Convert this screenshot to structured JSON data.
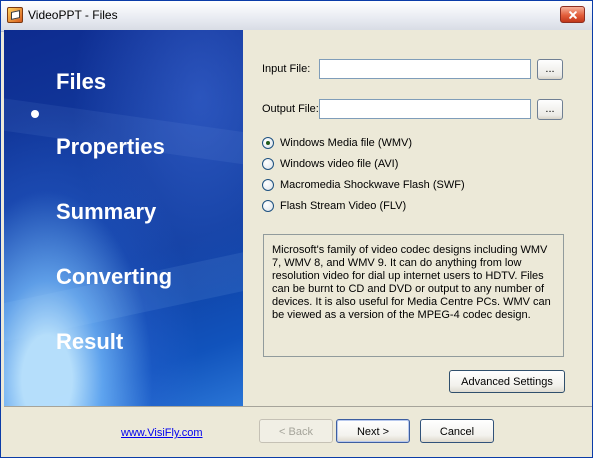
{
  "window": {
    "title": "VideoPPT - Files",
    "close_icon": "close-icon"
  },
  "sidebar": {
    "items": [
      {
        "label": "Files",
        "active": true
      },
      {
        "label": "Properties",
        "active": false
      },
      {
        "label": "Summary",
        "active": false
      },
      {
        "label": "Converting",
        "active": false
      },
      {
        "label": "Result",
        "active": false
      }
    ]
  },
  "form": {
    "input_label": "Input File:",
    "input_value": "",
    "output_label": "Output File:",
    "output_value": "",
    "browse_label": "...",
    "formats": [
      {
        "label": "Windows Media file (WMV)",
        "checked": true
      },
      {
        "label": "Windows video file (AVI)",
        "checked": false
      },
      {
        "label": "Macromedia Shockwave Flash (SWF)",
        "checked": false
      },
      {
        "label": "Flash Stream Video (FLV)",
        "checked": false
      }
    ],
    "description": "Microsoft's family of video codec designs including WMV 7, WMV 8, and WMV 9. It can do anything from low resolution video for dial up internet users to HDTV. Files can be burnt to CD and DVD or output to any number of devices. It is also useful for Media Centre PCs. WMV can be viewed as a version of the MPEG-4 codec design.",
    "advanced_settings_label": "Advanced Settings"
  },
  "footer": {
    "website": "www.VisiFly.com",
    "back_label": "< Back",
    "next_label": "Next >",
    "cancel_label": "Cancel"
  }
}
